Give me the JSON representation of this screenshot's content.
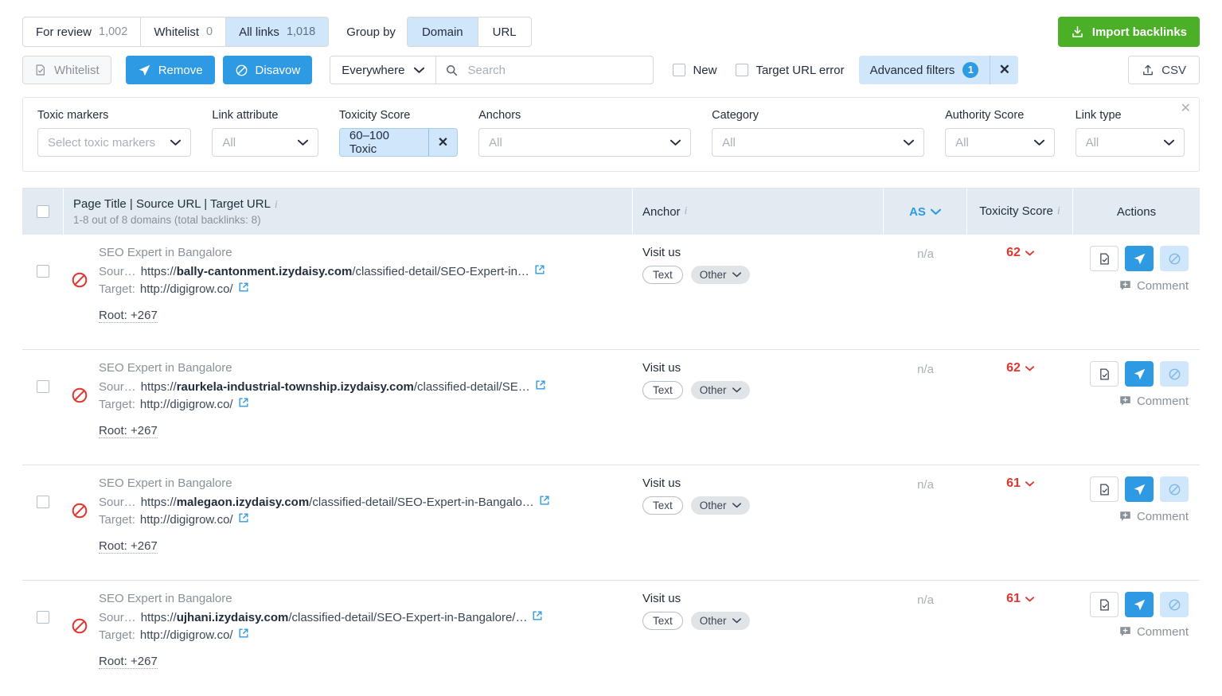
{
  "topbar": {
    "tabs": [
      {
        "label": "For review",
        "count": "1,002",
        "active": false
      },
      {
        "label": "Whitelist",
        "count": "0",
        "active": false
      },
      {
        "label": "All links",
        "count": "1,018",
        "active": true
      }
    ],
    "group_by_label": "Group by",
    "group_by_options": [
      {
        "label": "Domain",
        "active": true
      },
      {
        "label": "URL",
        "active": false
      }
    ],
    "import_button": "Import backlinks"
  },
  "toolbar": {
    "whitelist_label": "Whitelist",
    "remove_label": "Remove",
    "disavow_label": "Disavow",
    "scope_label": "Everywhere",
    "search_placeholder": "Search",
    "search_value": "",
    "new_label": "New",
    "target_url_error_label": "Target URL error",
    "advanced_filters_label": "Advanced filters",
    "advanced_filters_count": "1",
    "clear_filters_label": "✕",
    "csv_label": "CSV"
  },
  "filters": [
    {
      "label": "Toxic markers",
      "value": "Select toxic markers",
      "active": false
    },
    {
      "label": "Link attribute",
      "value": "All",
      "active": false
    },
    {
      "label": "Toxicity Score",
      "value": "60–100 Toxic",
      "active": true
    },
    {
      "label": "Anchors",
      "value": "All",
      "active": false
    },
    {
      "label": "Category",
      "value": "All",
      "active": false
    },
    {
      "label": "Authority Score",
      "value": "All",
      "active": false
    },
    {
      "label": "Link type",
      "value": "All",
      "active": false
    }
  ],
  "table": {
    "headers": {
      "title": "Page Title | Source URL | Target URL",
      "subtitle": "1-8 out of 8 domains (total backlinks: 8)",
      "anchor": "Anchor",
      "as": "AS",
      "toxicity": "Toxicity Score",
      "actions": "Actions"
    },
    "rows": [
      {
        "page_title": "SEO Expert in Bangalore",
        "source_prefix": "Sour…",
        "source_scheme": "https://",
        "source_domain": "bally-cantonment.izydaisy.com",
        "source_path": "/classified-detail/SEO-Expert-in…",
        "target_label": "Target:",
        "target_url": "http://digigrow.co/",
        "root_label": "Root: +267",
        "anchor": "Visit us",
        "tag_type": "Text",
        "tag_category": "Other",
        "as": "n/a",
        "toxicity": "62",
        "comment_label": "Comment"
      },
      {
        "page_title": "SEO Expert in Bangalore",
        "source_prefix": "Sour…",
        "source_scheme": "https://",
        "source_domain": "raurkela-industrial-township.izydaisy.com",
        "source_path": "/classified-detail/SE…",
        "target_label": "Target:",
        "target_url": "http://digigrow.co/",
        "root_label": "Root: +267",
        "anchor": "Visit us",
        "tag_type": "Text",
        "tag_category": "Other",
        "as": "n/a",
        "toxicity": "62",
        "comment_label": "Comment"
      },
      {
        "page_title": "SEO Expert in Bangalore",
        "source_prefix": "Sour…",
        "source_scheme": "https://",
        "source_domain": "malegaon.izydaisy.com",
        "source_path": "/classified-detail/SEO-Expert-in-Bangalo…",
        "target_label": "Target:",
        "target_url": "http://digigrow.co/",
        "root_label": "Root: +267",
        "anchor": "Visit us",
        "tag_type": "Text",
        "tag_category": "Other",
        "as": "n/a",
        "toxicity": "61",
        "comment_label": "Comment"
      },
      {
        "page_title": "SEO Expert in Bangalore",
        "source_prefix": "Sour…",
        "source_scheme": "https://",
        "source_domain": "ujhani.izydaisy.com",
        "source_path": "/classified-detail/SEO-Expert-in-Bangalore/…",
        "target_label": "Target:",
        "target_url": "http://digigrow.co/",
        "root_label": "Root: +267",
        "anchor": "Visit us",
        "tag_type": "Text",
        "tag_category": "Other",
        "as": "n/a",
        "toxicity": "61",
        "comment_label": "Comment"
      }
    ]
  },
  "colors": {
    "accent_blue": "#2f9ae4",
    "light_blue": "#cfe6fb",
    "green": "#4caf28",
    "toxic_red": "#e4342e",
    "highlight_orange": "#f5821f",
    "header_bg": "#e3ebf2"
  }
}
